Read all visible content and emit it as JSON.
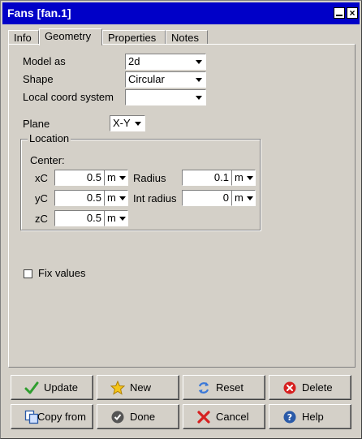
{
  "window": {
    "title": "Fans [fan.1]"
  },
  "tabs": [
    {
      "label": "Info"
    },
    {
      "label": "Geometry"
    },
    {
      "label": "Properties"
    },
    {
      "label": "Notes"
    }
  ],
  "form": {
    "model_as": {
      "label": "Model as",
      "value": "2d"
    },
    "shape": {
      "label": "Shape",
      "value": "Circular"
    },
    "local_coord": {
      "label": "Local coord system",
      "value": ""
    },
    "plane": {
      "label": "Plane",
      "value": "X-Y"
    }
  },
  "location": {
    "legend": "Location",
    "center_label": "Center:",
    "xc": {
      "label": "xC",
      "value": "0.5",
      "unit": "m"
    },
    "yc": {
      "label": "yC",
      "value": "0.5",
      "unit": "m"
    },
    "zc": {
      "label": "zC",
      "value": "0.5",
      "unit": "m"
    },
    "radius": {
      "label": "Radius",
      "value": "0.1",
      "unit": "m"
    },
    "int_radius": {
      "label": "Int radius",
      "value": "0",
      "unit": "m"
    }
  },
  "fix_values": {
    "label": "Fix values",
    "checked": false
  },
  "buttons": {
    "update": "Update",
    "new": "New",
    "reset": "Reset",
    "delete": "Delete",
    "copy_from": "Copy from",
    "done": "Done",
    "cancel": "Cancel",
    "help": "Help"
  },
  "colors": {
    "titlebar": "#0000c8",
    "window_bg": "#d4d0c8"
  }
}
